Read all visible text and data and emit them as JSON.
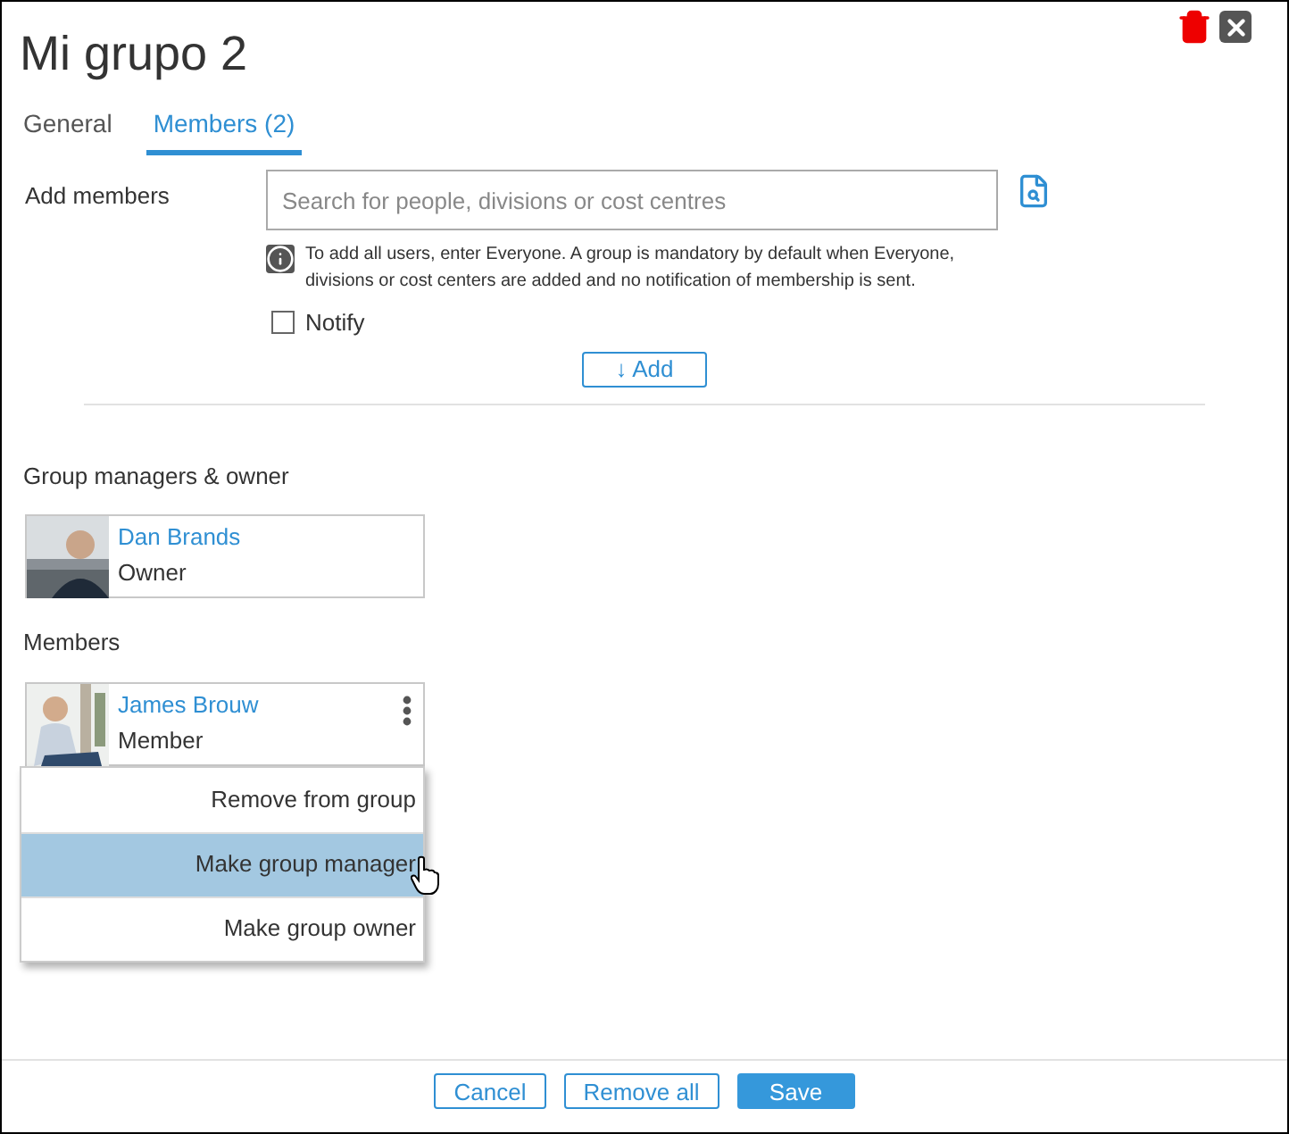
{
  "window": {
    "title": "Mi grupo 2"
  },
  "tabs": [
    {
      "label": "General",
      "selected": false
    },
    {
      "label": "Members (2)",
      "selected": true
    }
  ],
  "add_members": {
    "label": "Add members",
    "search": {
      "placeholder": "Search for people, divisions or cost centres"
    },
    "info": "To add all users, enter Everyone. A group is mandatory by default when Everyone, divisions or cost centers are added and no notification of membership is sent.",
    "notify": {
      "label": "Notify",
      "checked": false
    },
    "add_button": "↓ Add"
  },
  "managers": {
    "heading": "Group managers & owner",
    "people": [
      {
        "name": "Dan Brands",
        "role": "Owner"
      }
    ]
  },
  "members": {
    "heading": "Members",
    "people": [
      {
        "name": "James Brouw",
        "role": "Member"
      }
    ]
  },
  "context_menu": {
    "items": [
      {
        "label": "Remove from group",
        "selected": false
      },
      {
        "label": "Make group manager",
        "selected": true
      },
      {
        "label": "Make group owner",
        "selected": false
      }
    ]
  },
  "footer": {
    "buttons": [
      {
        "label": "Cancel",
        "kind": "outline"
      },
      {
        "label": "Remove all",
        "kind": "outline"
      },
      {
        "label": "Save",
        "kind": "primary"
      }
    ]
  }
}
